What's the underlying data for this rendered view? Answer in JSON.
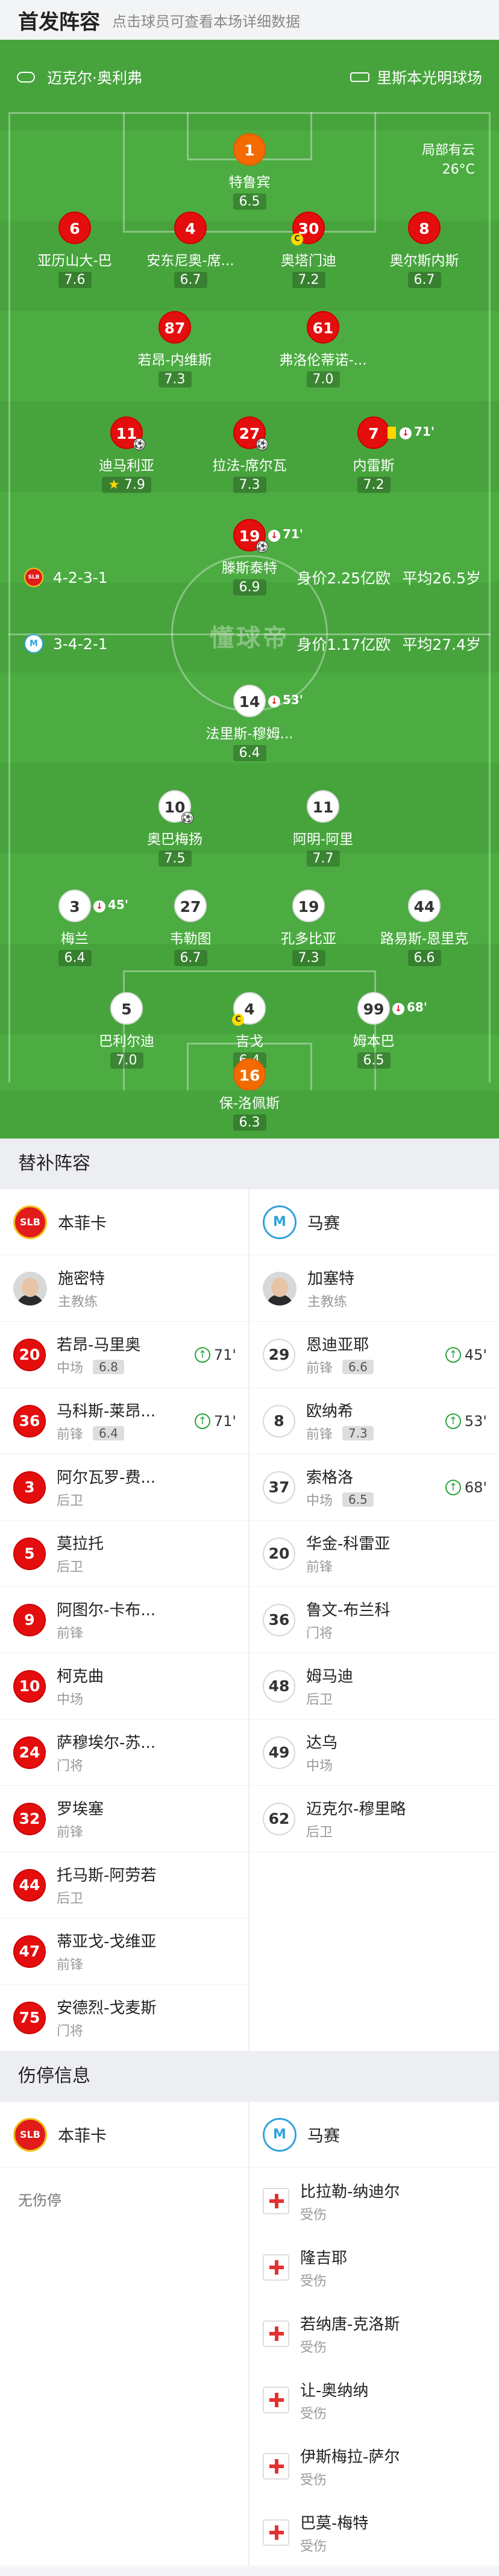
{
  "header": {
    "title": "首发阵容",
    "hint": "点击球员可查看本场详细数据"
  },
  "pitch": {
    "home_team": "迈克尔·奥利弗",
    "venue": "里斯本光明球场",
    "weather": "局部有云",
    "temperature": "26°C",
    "watermark": "懂球帝",
    "benfica_formation": "4-2-3-1",
    "benfica_value": "身价2.25亿欧",
    "benfica_age": "平均26.5岁",
    "marseille_formation": "3-4-2-1",
    "marseille_value": "身价1.17亿欧",
    "marseille_age": "平均27.4岁",
    "players": [
      {
        "num": "1",
        "name": "特鲁宾",
        "rating": "6.5",
        "color": "orange"
      },
      {
        "num": "6",
        "name": "亚历山大-巴",
        "rating": "7.6",
        "color": "red"
      },
      {
        "num": "4",
        "name": "安东尼奥-席...",
        "rating": "6.7",
        "color": "red"
      },
      {
        "num": "30",
        "name": "奥塔门迪",
        "rating": "7.2",
        "color": "red"
      },
      {
        "num": "8",
        "name": "奥尔斯内斯",
        "rating": "6.7",
        "color": "red"
      },
      {
        "num": "87",
        "name": "若昂-内维斯",
        "rating": "7.3",
        "color": "red"
      },
      {
        "num": "61",
        "name": "弗洛伦蒂诺-...",
        "rating": "7.0",
        "color": "red"
      },
      {
        "num": "11",
        "name": "迪马利亚",
        "rating": "7.9",
        "color": "red"
      },
      {
        "num": "27",
        "name": "拉法-席尔瓦",
        "rating": "7.3",
        "color": "red"
      },
      {
        "num": "7",
        "name": "内雷斯",
        "rating": "7.2",
        "color": "red",
        "sub": "71'"
      },
      {
        "num": "19",
        "name": "滕斯泰特",
        "rating": "6.9",
        "color": "red",
        "sub": "71'"
      },
      {
        "num": "14",
        "name": "法里斯-穆姆...",
        "rating": "6.4",
        "color": "white",
        "sub": "53'"
      },
      {
        "num": "10",
        "name": "奥巴梅扬",
        "rating": "7.5",
        "color": "white"
      },
      {
        "num": "11",
        "name": "阿明-阿里",
        "rating": "7.7",
        "color": "white"
      },
      {
        "num": "3",
        "name": "梅兰",
        "rating": "6.4",
        "color": "white",
        "sub": "45'"
      },
      {
        "num": "27",
        "name": "韦勒图",
        "rating": "6.7",
        "color": "white"
      },
      {
        "num": "19",
        "name": "孔多比亚",
        "rating": "7.3",
        "color": "white"
      },
      {
        "num": "44",
        "name": "路易斯-恩里克",
        "rating": "6.6",
        "color": "white"
      },
      {
        "num": "5",
        "name": "巴利尔迪",
        "rating": "7.0",
        "color": "white"
      },
      {
        "num": "4",
        "name": "吉戈",
        "rating": "6.4",
        "color": "white"
      },
      {
        "num": "99",
        "name": "姆本巴",
        "rating": "6.5",
        "color": "white",
        "sub": "68'"
      },
      {
        "num": "16",
        "name": "保-洛佩斯",
        "rating": "6.3",
        "color": "orange"
      }
    ]
  },
  "subs": {
    "title": "替补阵容",
    "left_team": "本菲卡",
    "right_team": "马赛",
    "left_coach": "施密特",
    "right_coach": "加塞特",
    "coach_role": "主教练",
    "left": [
      {
        "num": "20",
        "name": "若昂-马里奥",
        "pos": "中场",
        "rating": "6.8",
        "in": "71'"
      },
      {
        "num": "36",
        "name": "马科斯-莱昂...",
        "pos": "前锋",
        "rating": "6.4",
        "in": "71'"
      },
      {
        "num": "3",
        "name": "阿尔瓦罗-费...",
        "pos": "后卫"
      },
      {
        "num": "5",
        "name": "莫拉托",
        "pos": "后卫"
      },
      {
        "num": "9",
        "name": "阿图尔-卡布...",
        "pos": "前锋"
      },
      {
        "num": "10",
        "name": "柯克曲",
        "pos": "中场"
      },
      {
        "num": "24",
        "name": "萨穆埃尔-苏...",
        "pos": "门将"
      },
      {
        "num": "32",
        "name": "罗埃塞",
        "pos": "前锋"
      },
      {
        "num": "44",
        "name": "托马斯-阿劳若",
        "pos": "后卫"
      },
      {
        "num": "47",
        "name": "蒂亚戈-戈维亚",
        "pos": "前锋"
      },
      {
        "num": "75",
        "name": "安德烈-戈麦斯",
        "pos": "门将"
      }
    ],
    "right": [
      {
        "num": "29",
        "name": "恩迪亚耶",
        "pos": "前锋",
        "rating": "6.6",
        "in": "45'"
      },
      {
        "num": "8",
        "name": "欧纳希",
        "pos": "前锋",
        "rating": "7.3",
        "in": "53'"
      },
      {
        "num": "37",
        "name": "索格洛",
        "pos": "中场",
        "rating": "6.5",
        "in": "68'"
      },
      {
        "num": "20",
        "name": "华金-科雷亚",
        "pos": "前锋"
      },
      {
        "num": "36",
        "name": "鲁文-布兰科",
        "pos": "门将"
      },
      {
        "num": "48",
        "name": "姆马迪",
        "pos": "后卫"
      },
      {
        "num": "49",
        "name": "达乌",
        "pos": "中场"
      },
      {
        "num": "62",
        "name": "迈克尔-穆里略",
        "pos": "后卫"
      }
    ]
  },
  "injuries": {
    "title": "伤停信息",
    "left_team": "本菲卡",
    "right_team": "马赛",
    "none": "无伤停",
    "right": [
      {
        "name": "比拉勒-纳迪尔",
        "status": "受伤"
      },
      {
        "name": "隆吉耶",
        "status": "受伤"
      },
      {
        "name": "若纳唐-克洛斯",
        "status": "受伤"
      },
      {
        "name": "让-奥纳纳",
        "status": "受伤"
      },
      {
        "name": "伊斯梅拉-萨尔",
        "status": "受伤"
      },
      {
        "name": "巴莫-梅特",
        "status": "受伤"
      }
    ]
  }
}
